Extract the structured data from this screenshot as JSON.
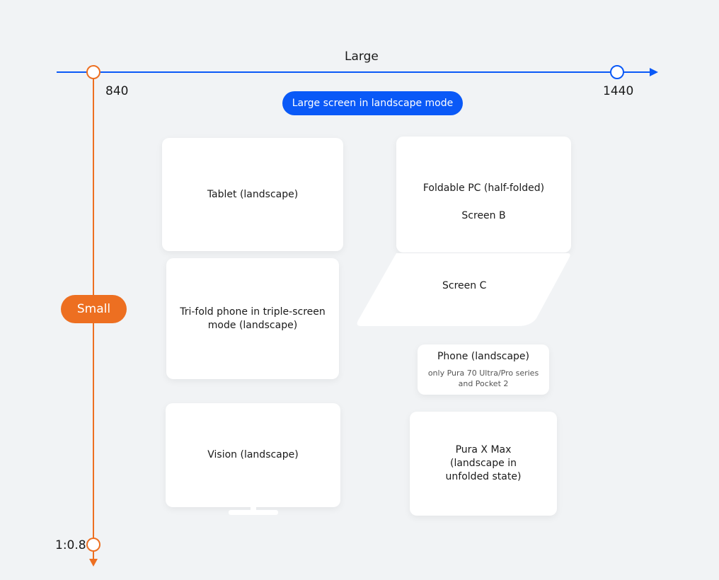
{
  "horizontal_axis": {
    "label": "Large",
    "start_tick": "840",
    "end_tick": "1440",
    "color": "#0a59f7"
  },
  "vertical_axis": {
    "label": "Small",
    "end_tick": "1:0.8",
    "color": "#ed6f21"
  },
  "badge": {
    "text": "Large screen in landscape mode",
    "color": "#0a59f7"
  },
  "devices": {
    "tablet": "Tablet (landscape)",
    "foldable_pc": "Foldable PC (half-folded)",
    "screen_b": "Screen B",
    "screen_c": "Screen C",
    "trifold": "Tri-fold phone in triple-screen mode (landscape)",
    "phone": "Phone (landscape)",
    "phone_note": "only Pura 70 Ultra/Pro series and Pocket 2",
    "vision": "Vision (landscape)",
    "pura_x_max_line1": "Pura X Max",
    "pura_x_max_line2": "(landscape in",
    "pura_x_max_line3": "unfolded state)"
  },
  "icons": [
    "right-arrow-icon",
    "down-arrow-icon"
  ]
}
